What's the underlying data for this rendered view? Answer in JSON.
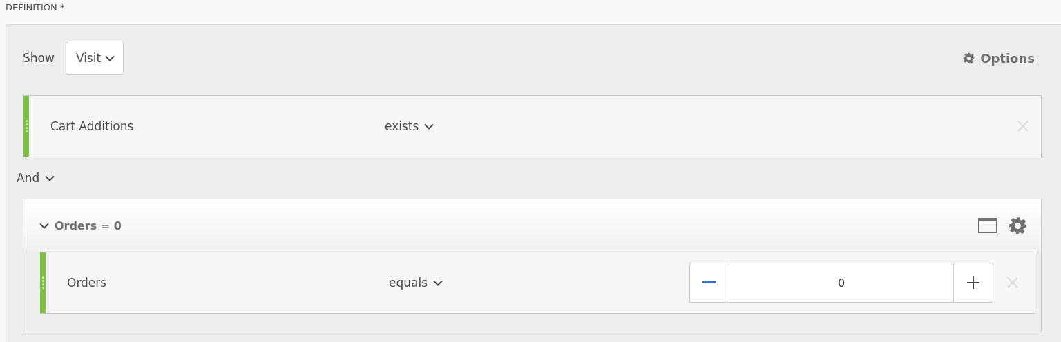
{
  "section_label": "DEFINITION *",
  "show": {
    "label": "Show",
    "value": "Visit"
  },
  "options": {
    "label": "Options"
  },
  "rules": [
    {
      "kind": "plain",
      "metric": "Cart Additions",
      "operator": "exists"
    }
  ],
  "logic": {
    "label": "And"
  },
  "container": {
    "title": "Orders = 0",
    "expanded": true,
    "rules": [
      {
        "kind": "numeric",
        "metric": "Orders",
        "operator": "equals",
        "value": "0"
      }
    ]
  }
}
